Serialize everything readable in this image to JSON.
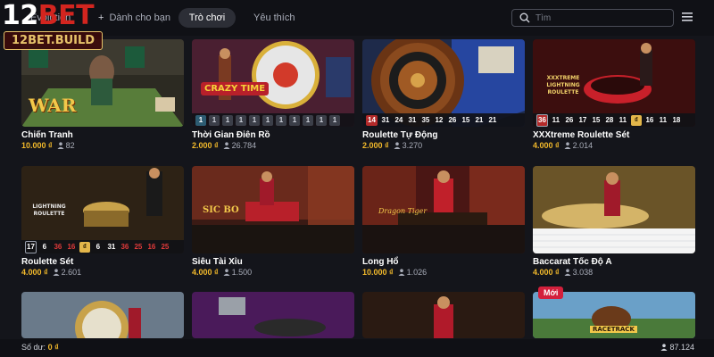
{
  "brand": {
    "logo_main": "12",
    "logo_accent": "BET",
    "domain": "12BET.BUILD"
  },
  "nav": {
    "item_1": "Evolution",
    "item_2": "Dành cho bạn",
    "item_3": "Trò chơi",
    "item_4": "Yêu thích",
    "active": "Trò chơi"
  },
  "search": {
    "placeholder": "Tìm"
  },
  "icons": {
    "search": "search-icon",
    "menu": "menu-icon",
    "players": "person-icon"
  },
  "colors": {
    "price": "#f2b92b",
    "accent": "#d3251f",
    "new_badge": "#d3203c",
    "background": "#14151b"
  },
  "games": [
    {
      "title": "Chiến Tranh",
      "price": "10.000 ₫",
      "players": "82",
      "thumb_label": "WAR"
    },
    {
      "title": "Thời Gian Điên Rồ",
      "price": "2.000 ₫",
      "players": "26.784",
      "thumb_label": "CRAZY TIME",
      "results": [
        "1",
        "1",
        "1",
        "1",
        "1",
        "1",
        "1",
        "1",
        "1",
        "1",
        "1"
      ]
    },
    {
      "title": "Roulette Tự Động",
      "price": "2.000 ₫",
      "players": "3.270",
      "results": [
        "14",
        "31",
        "24",
        "31",
        "35",
        "12",
        "26",
        "15",
        "21",
        "21"
      ]
    },
    {
      "title": "XXXtreme Roulette Sét",
      "price": "4.000 ₫",
      "players": "2.014",
      "thumb_label": "XXXTREME LIGHTNING ROULETTE",
      "results": [
        "36",
        "11",
        "26",
        "17",
        "15",
        "28",
        "11",
        "₫",
        "16",
        "11",
        "18"
      ]
    },
    {
      "title": "Roulette Sét",
      "price": "4.000 ₫",
      "players": "2.601",
      "thumb_label": "LIGHTNING ROULETTE",
      "results": [
        "17",
        "6",
        "36",
        "16",
        "₫",
        "6",
        "31",
        "36",
        "25",
        "16",
        "25"
      ]
    },
    {
      "title": "Siêu Tài Xỉu",
      "price": "4.000 ₫",
      "players": "1.500",
      "thumb_label": "SIC BO"
    },
    {
      "title": "Long Hổ",
      "price": "10.000 ₫",
      "players": "1.026",
      "thumb_label": "Dragon Tiger"
    },
    {
      "title": "Baccarat Tốc Độ A",
      "price": "4.000 ₫",
      "players": "3.038"
    },
    {
      "title": "",
      "price": "",
      "players": ""
    },
    {
      "title": "",
      "price": "",
      "players": ""
    },
    {
      "title": "",
      "price": "",
      "players": ""
    },
    {
      "title": "",
      "price": "",
      "players": "",
      "badge": "Mới",
      "thumb_label": "RACETRACK"
    }
  ],
  "footer": {
    "balance_label": "Số dư:",
    "balance_value": "0 ₫",
    "online_count": "87.124"
  }
}
